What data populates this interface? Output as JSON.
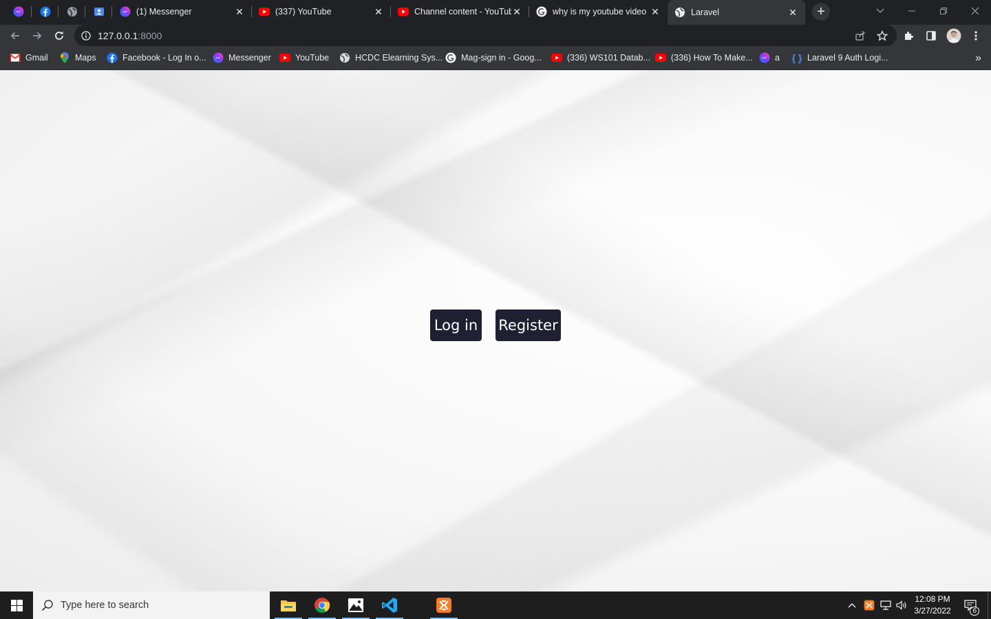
{
  "browser": {
    "tabs": [
      {
        "title": "(1) Messenger",
        "icon": "messenger-icon"
      },
      {
        "title": "(337) YouTube",
        "icon": "youtube-icon"
      },
      {
        "title": "Channel content - YouTube",
        "icon": "youtube-icon"
      },
      {
        "title": "why is my youtube video",
        "icon": "google-icon"
      },
      {
        "title": "Laravel",
        "icon": "globe-icon",
        "active": true
      }
    ],
    "pinned_tabs": [
      "messenger-icon",
      "facebook-icon",
      "globe-icon",
      "photos-icon"
    ],
    "address": {
      "host": "127.0.0.1",
      "port": ":8000"
    },
    "bookmarks": [
      {
        "label": "Gmail",
        "icon": "gmail-icon"
      },
      {
        "label": "Maps",
        "icon": "maps-icon"
      },
      {
        "label": "Facebook - Log In o...",
        "icon": "facebook-icon"
      },
      {
        "label": "Messenger",
        "icon": "messenger-icon"
      },
      {
        "label": "YouTube",
        "icon": "youtube-icon"
      },
      {
        "label": "HCDC Elearning Sys...",
        "icon": "globe-icon"
      },
      {
        "label": "Mag-sign in - Goog...",
        "icon": "google-icon"
      },
      {
        "label": "(336) WS101 Datab...",
        "icon": "youtube-icon"
      },
      {
        "label": "(336) How To Make...",
        "icon": "youtube-icon"
      },
      {
        "label": "a",
        "icon": "messenger-icon"
      },
      {
        "label": "Laravel 9 Auth Logi...",
        "icon": "brackets-icon"
      }
    ]
  },
  "page": {
    "login_label": "Log in",
    "register_label": "Register"
  },
  "taskbar": {
    "search_placeholder": "Type here to search",
    "time": "12:08 PM",
    "date": "3/27/2022",
    "notification_count": "6"
  },
  "colors": {
    "button_bg": "#1f2133",
    "chrome_dark": "#202124",
    "chrome_toolbar": "#35363a"
  }
}
